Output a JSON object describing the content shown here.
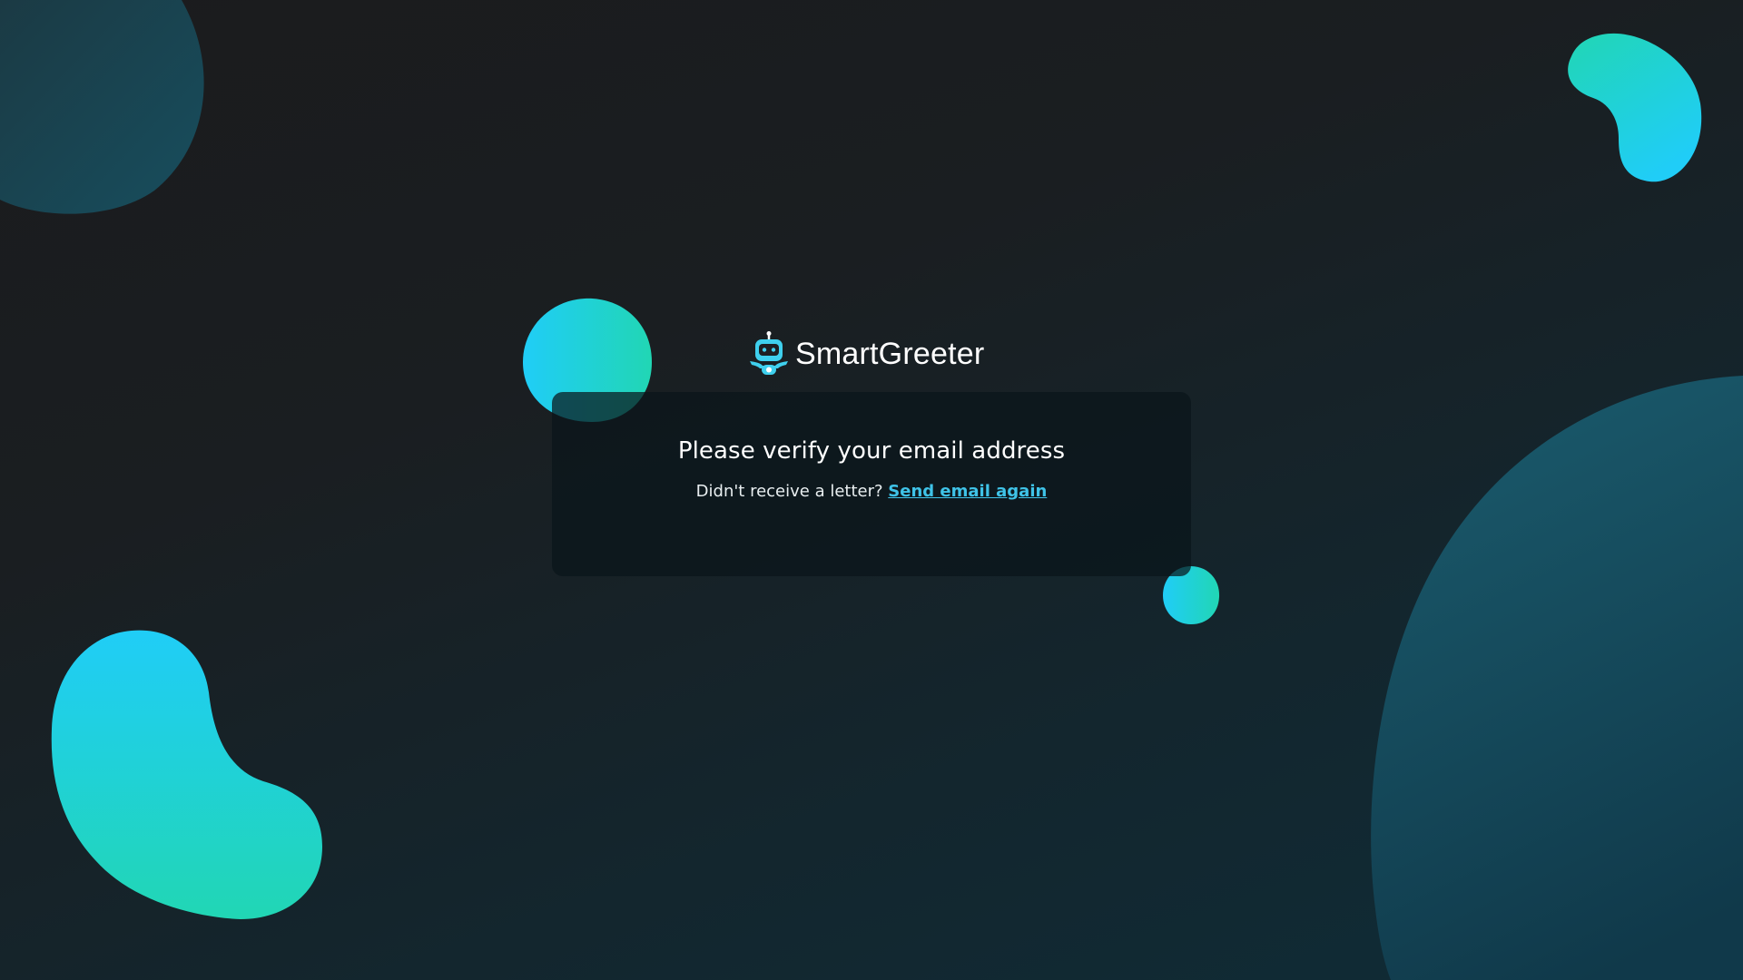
{
  "brand": {
    "name": "SmartGreeter",
    "logo_icon": "robot-icon"
  },
  "verify": {
    "title": "Please verify your email address",
    "prompt": "Didn't receive a letter?",
    "link_label": "Send email again"
  },
  "colors": {
    "background_dark": "#1b1b1d",
    "background_teal": "#0f2c37",
    "accent_cyan": "#20cdf7",
    "accent_green": "#21d6b4",
    "link": "#3fc3e8",
    "card": "#0a151a"
  }
}
